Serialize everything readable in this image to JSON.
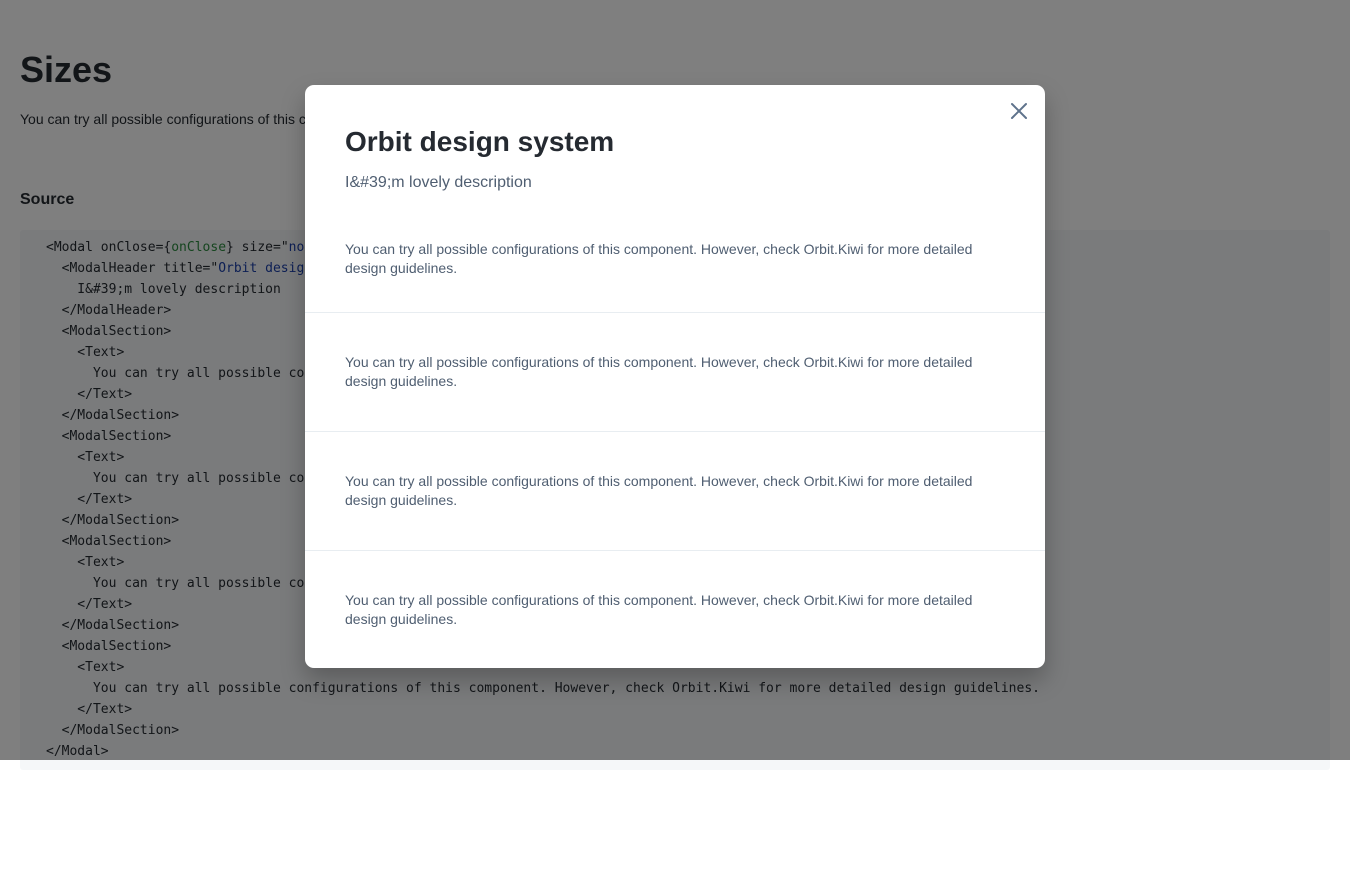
{
  "page": {
    "title": "Sizes",
    "description": "You can try all possible configurations of this component. However, check Orbit.Kiwi for more detailed design guidelines.",
    "source_label": "Source"
  },
  "code": {
    "lines": [
      [
        {
          "t": "<Modal onClose={"
        },
        {
          "t": "onClose",
          "c": "fn"
        },
        {
          "t": "} size=\""
        },
        {
          "t": "normal",
          "c": "str"
        },
        {
          "t": "\">"
        }
      ],
      [
        {
          "t": "  <ModalHeader title=\""
        },
        {
          "t": "Orbit design system",
          "c": "str"
        },
        {
          "t": "\">"
        }
      ],
      [
        {
          "t": "    I&#39;m lovely description"
        }
      ],
      [
        {
          "t": "  </ModalHeader>"
        }
      ],
      [
        {
          "t": "  <ModalSection>"
        }
      ],
      [
        {
          "t": "    <Text>"
        }
      ],
      [
        {
          "t": "      You can try all possible configurations of this component. However, check Orbit.Kiwi for more detailed design guidelines."
        }
      ],
      [
        {
          "t": "    </Text>"
        }
      ],
      [
        {
          "t": "  </ModalSection>"
        }
      ],
      [
        {
          "t": "  <ModalSection>"
        }
      ],
      [
        {
          "t": "    <Text>"
        }
      ],
      [
        {
          "t": "      You can try all possible configurations of this component. However, check Orbit.Kiwi for more detailed design guidelines."
        }
      ],
      [
        {
          "t": "    </Text>"
        }
      ],
      [
        {
          "t": "  </ModalSection>"
        }
      ],
      [
        {
          "t": "  <ModalSection>"
        }
      ],
      [
        {
          "t": "    <Text>"
        }
      ],
      [
        {
          "t": "      You can try all possible configurations of this component. However, check Orbit.Kiwi for more detailed design guidelines."
        }
      ],
      [
        {
          "t": "    </Text>"
        }
      ],
      [
        {
          "t": "  </ModalSection>"
        }
      ],
      [
        {
          "t": "  <ModalSection>"
        }
      ],
      [
        {
          "t": "    <Text>"
        }
      ],
      [
        {
          "t": "      You can try all possible configurations of this component. However, check Orbit.Kiwi for more detailed design guidelines."
        }
      ],
      [
        {
          "t": "    </Text>"
        }
      ],
      [
        {
          "t": "  </ModalSection>"
        }
      ],
      [
        {
          "t": "</Modal>"
        }
      ]
    ]
  },
  "modal": {
    "title": "Orbit design system",
    "description": "I&#39;m lovely description",
    "close_icon": "close-icon",
    "sections": [
      "You can try all possible configurations of this component. However, check Orbit.Kiwi for more detailed design guidelines.",
      "You can try all possible configurations of this component. However, check Orbit.Kiwi for more detailed design guidelines.",
      "You can try all possible configurations of this component. However, check Orbit.Kiwi for more detailed design guidelines.",
      "You can try all possible configurations of this component. However, check Orbit.Kiwi for more detailed design guidelines."
    ]
  },
  "colors": {
    "text_primary": "#252a31",
    "text_secondary": "#4f5e71",
    "code_function": "#2b8a3e",
    "code_string": "#1a3ea8",
    "code_background": "#f5f7f9",
    "overlay": "rgba(0, 0, 0, 0.5)",
    "close_icon": "#5f738c"
  }
}
